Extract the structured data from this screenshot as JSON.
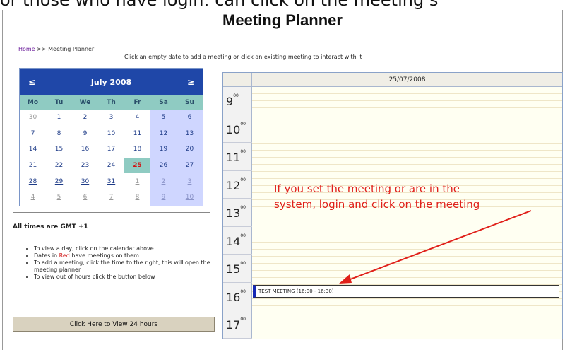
{
  "banner_text": "or those who have login: can click on the meeting s",
  "title": "Meeting Planner",
  "breadcrumb": {
    "home": "Home",
    "rest": ">> Meeting Planner"
  },
  "hint": "Click an empty date to add a meeting or click an existing meeting to interact with it",
  "calendar": {
    "month_title": "July 2008",
    "prev": "≤",
    "next": "≥",
    "dow": [
      "Mo",
      "Tu",
      "We",
      "Th",
      "Fr",
      "Sa",
      "Su"
    ],
    "weeks": [
      [
        "30",
        "1",
        "2",
        "3",
        "4",
        "5",
        "6"
      ],
      [
        "7",
        "8",
        "9",
        "10",
        "11",
        "12",
        "13"
      ],
      [
        "14",
        "15",
        "16",
        "17",
        "18",
        "19",
        "20"
      ],
      [
        "21",
        "22",
        "23",
        "24",
        "25",
        "26",
        "27"
      ],
      [
        "28",
        "29",
        "30",
        "31",
        "1",
        "2",
        "3"
      ],
      [
        "4",
        "5",
        "6",
        "7",
        "8",
        "9",
        "10"
      ]
    ]
  },
  "gmt": "All times are GMT +1",
  "notes": {
    "n1": "To view a day, click on the calendar above.",
    "n2_pre": "Dates in ",
    "n2_red": "Red",
    "n2_post": " have meetings on them",
    "n3": "To add a meeting, click the time to the right, this will open the meeting planner",
    "n4": "To view out of hours click the button below"
  },
  "button_24h": "Click Here to View 24 hours",
  "day": {
    "date": "25/07/2008",
    "hours": [
      "9",
      "10",
      "11",
      "12",
      "13",
      "14",
      "15",
      "16",
      "17"
    ],
    "minutes": "00"
  },
  "meeting": "TEST MEETING (16:00 - 16:30)",
  "annotation": {
    "line1": "If you set the meeting or are in the",
    "line2": "system, login and click on the meeting"
  },
  "colors": {
    "header_blue": "#1f47a8",
    "teal": "#8fcbc2",
    "weekend": "#cfd6ff",
    "red": "#d01515",
    "annotation_red": "#e0201a"
  }
}
